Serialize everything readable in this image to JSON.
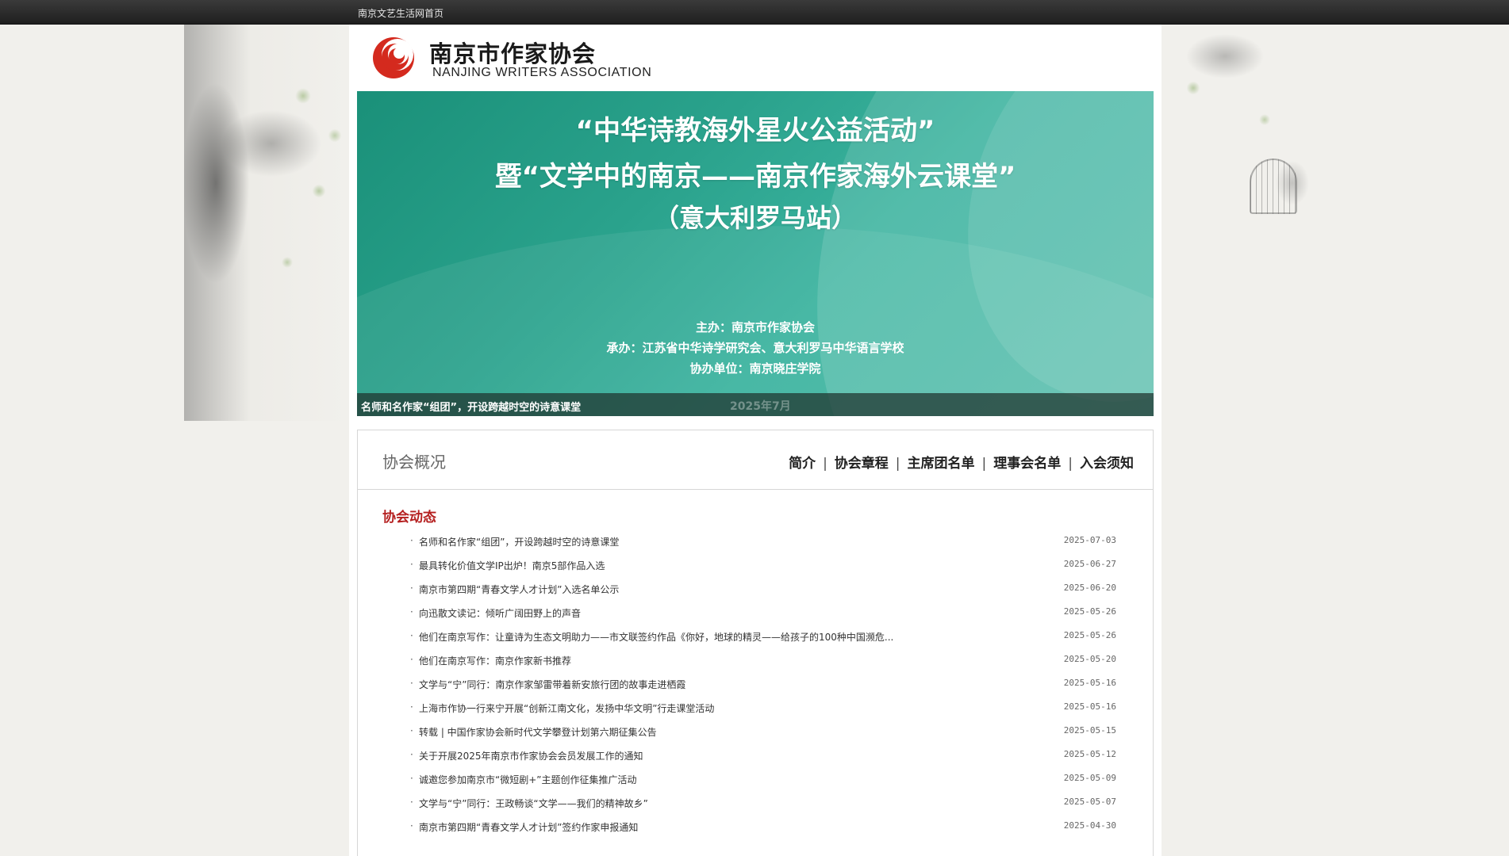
{
  "topbar": {
    "home_link": "南京文艺生活网首页"
  },
  "logo": {
    "cn": "南京市作家协会",
    "en": "NANJING WRITERS ASSOCIATION",
    "color": "#d42a1e"
  },
  "banner": {
    "line1": "“中华诗教海外星火公益活动”",
    "line2": "暨“文学中的南京——南京作家海外云课堂”",
    "line3": "（意大利罗马站）",
    "organizer": "主办：南京市作家协会",
    "co_organizer": "承办：江苏省中华诗学研究会、意大利罗马中华语言学校",
    "assist": "协办单位：南京晓庄学院",
    "caption": "名师和名作家“组团”，开设跨越时空的诗意课堂",
    "caption_date": "2025年7月"
  },
  "overview": {
    "title": "协会概况",
    "links": [
      "简介",
      "协会章程",
      "主席团名单",
      "理事会名单",
      "入会须知"
    ]
  },
  "news": {
    "title": "协会动态",
    "items": [
      {
        "text": "名师和名作家“组团”，开设跨越时空的诗意课堂",
        "date": "2025-07-03"
      },
      {
        "text": "最具转化价值文学IP出炉！南京5部作品入选",
        "date": "2025-06-27"
      },
      {
        "text": "南京市第四期“青春文学人才计划”入选名单公示",
        "date": "2025-06-20"
      },
      {
        "text": "向迅散文读记：倾听广阔田野上的声音",
        "date": "2025-05-26"
      },
      {
        "text": "他们在南京写作：让童诗为生态文明助力——市文联签约作品《你好，地球的精灵——给孩子的100种中国濒危...",
        "date": "2025-05-26"
      },
      {
        "text": "他们在南京写作：南京作家新书推荐",
        "date": "2025-05-20"
      },
      {
        "text": "文学与“宁”同行：南京作家邹雷带着新安旅行团的故事走进栖霞",
        "date": "2025-05-16"
      },
      {
        "text": "上海市作协一行来宁开展“创新江南文化，发扬中华文明”行走课堂活动",
        "date": "2025-05-16"
      },
      {
        "text": "转载 | 中国作家协会新时代文学攀登计划第六期征集公告",
        "date": "2025-05-15"
      },
      {
        "text": "关于开展2025年南京市作家协会会员发展工作的通知",
        "date": "2025-05-12"
      },
      {
        "text": "诚邀您参加南京市“微短剧+”主题创作征集推广活动",
        "date": "2025-05-09"
      },
      {
        "text": "文学与“宁”同行：王政畅谈“文学——我们的精神故乡”",
        "date": "2025-05-07"
      },
      {
        "text": "南京市第四期“青春文学人才计划”签约作家申报通知",
        "date": "2025-04-30"
      }
    ]
  }
}
